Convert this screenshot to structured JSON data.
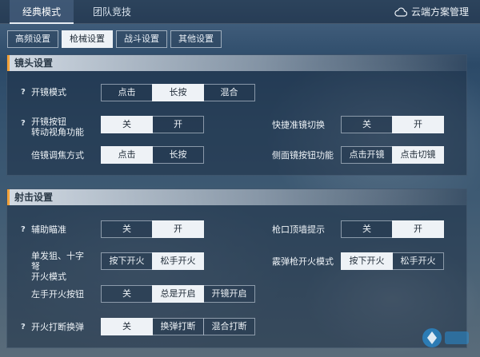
{
  "main_tabs": [
    {
      "label": "经典模式",
      "active": true
    },
    {
      "label": "团队竞技",
      "active": false
    }
  ],
  "cloud_manage_label": "云端方案管理",
  "sub_tabs": [
    {
      "label": "高频设置",
      "active": false
    },
    {
      "label": "枪械设置",
      "active": true
    },
    {
      "label": "战斗设置",
      "active": false
    },
    {
      "label": "其他设置",
      "active": false
    }
  ],
  "scope_section": {
    "title": "镜头设置",
    "scope_mode": {
      "label": "开镜模式",
      "options": [
        "点击",
        "长按",
        "混合"
      ],
      "selected": 1
    },
    "scope_button_view": {
      "label_line1": "开镜按钮",
      "label_line2": "转动视角功能",
      "options": [
        "关",
        "开"
      ],
      "selected": 0
    },
    "quick_scope_switch": {
      "label": "快捷准镜切换",
      "options": [
        "关",
        "开"
      ],
      "selected": 1
    },
    "zoom_mode": {
      "label": "倍镜调焦方式",
      "options": [
        "点击",
        "长按"
      ],
      "selected": 0
    },
    "side_scope_button": {
      "label": "侧面镜按钮功能",
      "options": [
        "点击开镜",
        "点击切镜"
      ],
      "selected": 1
    }
  },
  "shoot_section": {
    "title": "射击设置",
    "aim_assist": {
      "label": "辅助瞄准",
      "options": [
        "关",
        "开"
      ],
      "selected": 1
    },
    "muzzle_wall_hint": {
      "label": "枪口顶墙提示",
      "options": [
        "关",
        "开"
      ],
      "selected": 1
    },
    "single_fire_mode": {
      "label_line1": "单发狙、十字",
      "label_line2": "弩",
      "label_line3": "开火模式",
      "options": [
        "按下开火",
        "松手开火"
      ],
      "selected": 1
    },
    "shotgun_fire_mode": {
      "label": "霰弹枪开火模式",
      "options": [
        "按下开火",
        "松手开火"
      ],
      "selected": 0
    },
    "left_fire_button": {
      "label": "左手开火按钮",
      "options": [
        "关",
        "总是开启",
        "开镜开启"
      ],
      "selected": 1
    },
    "fire_interrupt_reload": {
      "label": "开火打断换弹",
      "options": [
        "关",
        "换弹打断",
        "混合打断"
      ],
      "selected": 0
    }
  },
  "help_mark": "?"
}
